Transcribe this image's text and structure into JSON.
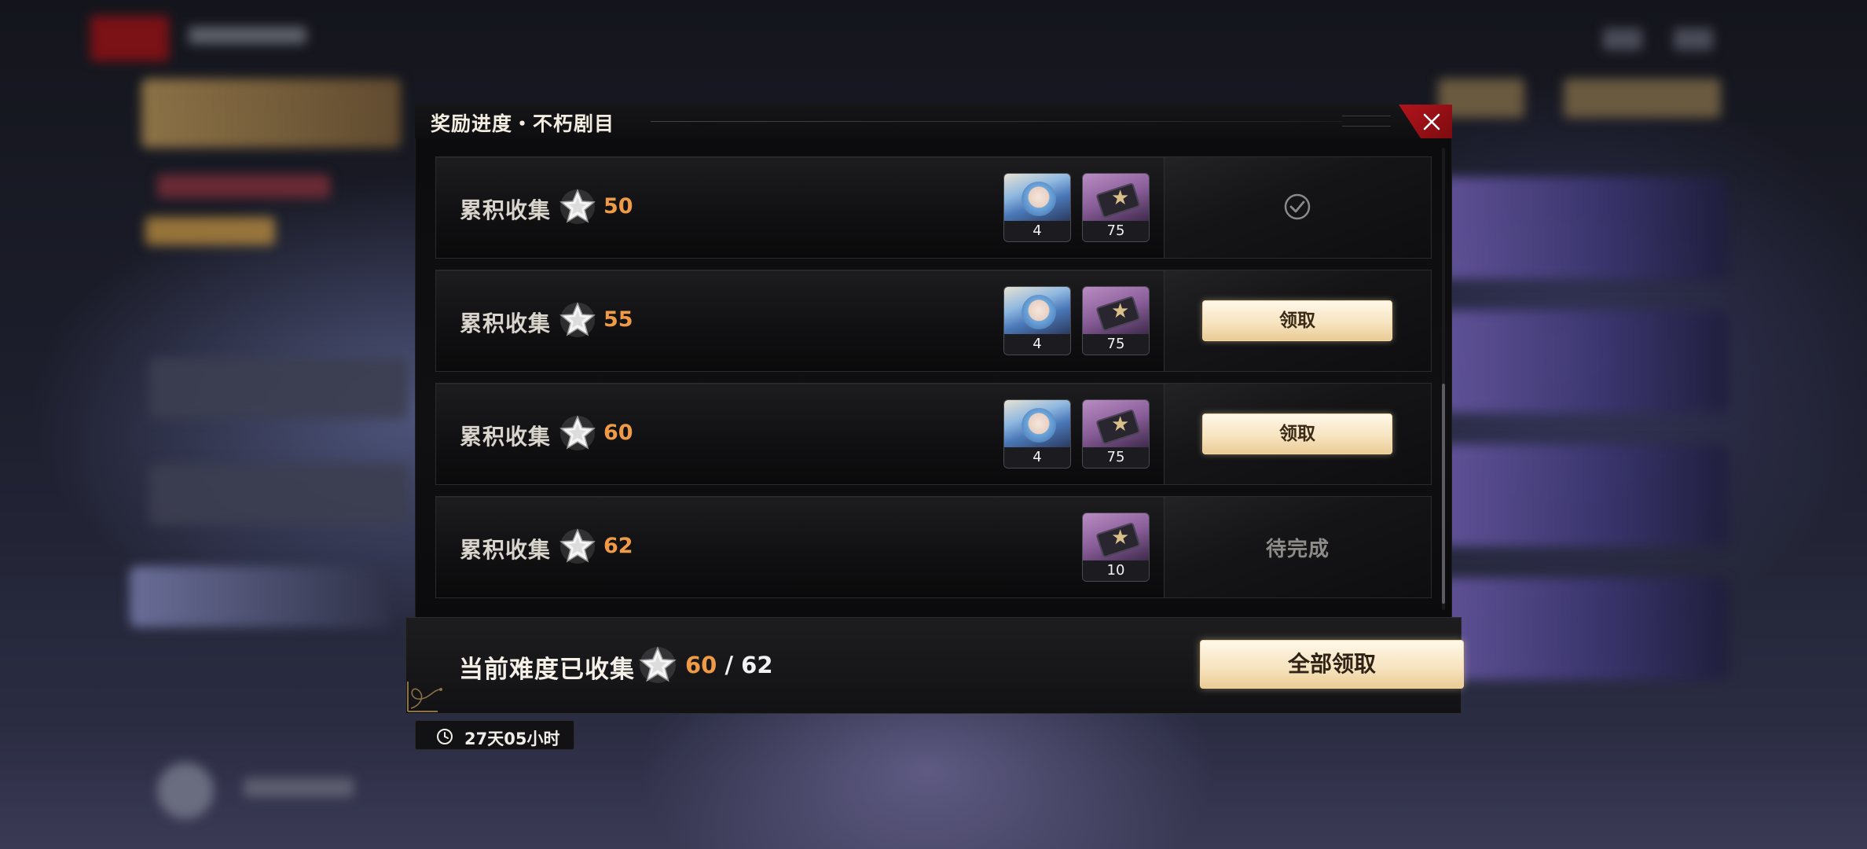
{
  "modal": {
    "title": "奖励进度・不朽剧目"
  },
  "rows": [
    {
      "label": "累积收集",
      "stars": "50",
      "status": "claimed",
      "action_text": "",
      "items": [
        {
          "icon": "character-avatar",
          "qty": "4"
        },
        {
          "icon": "ticket-card",
          "qty": "75"
        }
      ]
    },
    {
      "label": "累积收集",
      "stars": "55",
      "status": "claimable",
      "action_text": "领取",
      "items": [
        {
          "icon": "character-avatar",
          "qty": "4"
        },
        {
          "icon": "ticket-card",
          "qty": "75"
        }
      ]
    },
    {
      "label": "累积收集",
      "stars": "60",
      "status": "claimable",
      "action_text": "领取",
      "items": [
        {
          "icon": "character-avatar",
          "qty": "4"
        },
        {
          "icon": "ticket-card",
          "qty": "75"
        }
      ]
    },
    {
      "label": "累积收集",
      "stars": "62",
      "status": "pending",
      "action_text": "待完成",
      "items": [
        {
          "icon": "ticket-card",
          "qty": "10"
        }
      ]
    }
  ],
  "footer": {
    "label": "当前难度已收集",
    "current": "60",
    "separator": " / ",
    "total": "62",
    "claim_all": "全部领取"
  },
  "timer": {
    "text": "27天05小时"
  },
  "colors": {
    "accent_orange": "#ee9a46",
    "button_gold": "#f6e2bd",
    "close_red": "#b3141c"
  }
}
